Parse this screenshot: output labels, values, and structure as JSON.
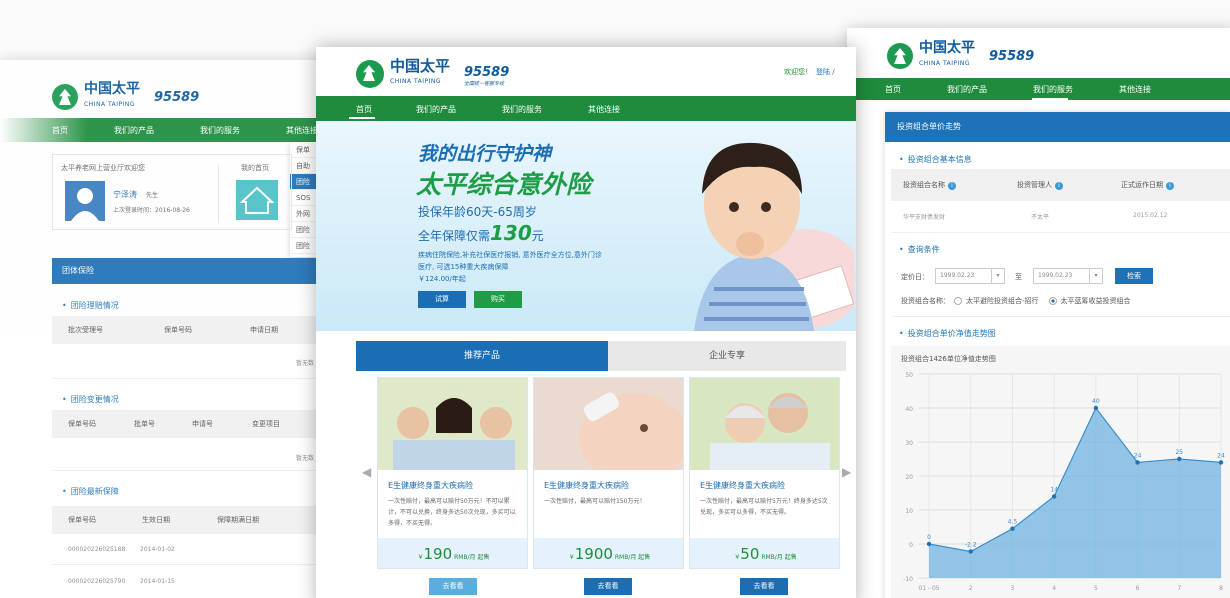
{
  "brand": {
    "cn": "中国太平",
    "en": "CHINA TAIPING",
    "phone": "95589",
    "slogan": "全国统一客服专线"
  },
  "left": {
    "nav": [
      "首页",
      "我们的产品",
      "我们的服务",
      "其他连接"
    ],
    "dropdown": [
      "保单",
      "自助",
      "团险",
      "SOS",
      "外网",
      "团险",
      "团险"
    ],
    "card": {
      "title": "太平养老网上营业厅欢迎您",
      "name": "宁泽涛",
      "title_suffix": "先生",
      "last_login": "上次登录时间：2016-08-26",
      "home": "我的首页"
    },
    "bar": "团体保险",
    "s1": {
      "title": "团险理赔情况",
      "cols": [
        "批次受理号",
        "保单号码",
        "申请日期"
      ],
      "empty": "暂无数"
    },
    "s2": {
      "title": "团险变更情况",
      "cols": [
        "保单号码",
        "批单号",
        "申请号",
        "变更项目"
      ],
      "empty": "暂无数"
    },
    "s3": {
      "title": "团险最新保障",
      "cols": [
        "保单号码",
        "生效日期",
        "保障期满日期"
      ],
      "rows": [
        [
          "000020226025188",
          "2014-01-02"
        ],
        [
          "000020226025790",
          "2014-01-15"
        ]
      ]
    }
  },
  "center": {
    "welcome": "欢迎您！",
    "login": "登陆",
    "nav": [
      "首页",
      "我们的产品",
      "我们的服务",
      "其他连接"
    ],
    "hero": {
      "line1": "我的出行守护神",
      "line2": "太平综合意外险",
      "line3": "投保年龄60天-65周岁",
      "line4a": "全年保障仅需",
      "line4b": "130",
      "line4c": "元",
      "desc": "疾病住院保险,补充社保医疗报销, 意外医疗全方位,意外门诊医疗, 可选15种重大疾病保障",
      "price": "￥124.00/年起",
      "btn_try": "试算",
      "btn_buy": "购买"
    },
    "tabs": [
      "推荐产品",
      "企业专享"
    ],
    "products": [
      {
        "title": "E生健康终身重大疾病险",
        "desc": "一次性赔付，最高可以赔付50万元！不可以累计，不可以兑换，终身多达50次兑现，多买可以多得，不买无得。",
        "price": "190",
        "unit": "RMB/月 起售"
      },
      {
        "title": "E生健康终身重大疾病险",
        "desc": "一次性赔付，最高可以赔付150万元！",
        "price": "1900",
        "unit": "RMB/月 起售"
      },
      {
        "title": "E生健康终身重大疾病险",
        "desc": "一次性赔付，最高可以赔付5万元！终身多达5次兑现，多买可以多得，不买无得。",
        "price": "50",
        "unit": "RMB/月 起售"
      }
    ],
    "see": "去看看"
  },
  "right": {
    "nav": [
      "首页",
      "我们的产品",
      "我们的服务",
      "其他连接"
    ],
    "bar": "投资组合单价走势",
    "basic": {
      "title": "投资组合基本信息",
      "cols": [
        "投资组合名称",
        "投资管理人",
        "正式运作日期"
      ],
      "row": [
        "华平支财债发财",
        "不太平",
        "2015.02.12"
      ]
    },
    "query": {
      "title": "查询条件",
      "price_date_label": "定价日：",
      "from": "1999.02.23",
      "to_label": "至",
      "to": "1999.02.23",
      "search": "检索",
      "name_label": "投资组合名称：",
      "opt1": "太平避险投资组合-招行",
      "opt2": "太平蓝筹收益投资组合"
    },
    "trend": {
      "title": "投资组合单价净值走势图",
      "chart_title": "投资组合1426单位净值走势图"
    }
  },
  "chart_data": {
    "type": "area",
    "x": [
      "01 - 05",
      "2",
      "3",
      "4",
      "5",
      "6",
      "7",
      "8"
    ],
    "values": [
      0,
      -2.2,
      4.5,
      14,
      40,
      24,
      25,
      24
    ],
    "ylim": [
      -10,
      50
    ],
    "yticks": [
      -10,
      0,
      10,
      20,
      30,
      40,
      50
    ],
    "color": "#6fb3e0"
  }
}
